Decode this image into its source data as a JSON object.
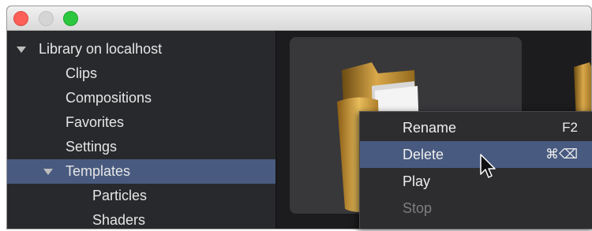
{
  "window": {
    "controls": {
      "close": "close-button",
      "minimize": "minimize-button",
      "zoom": "zoom-button"
    }
  },
  "sidebar": {
    "root_label": "Library on localhost",
    "items": [
      {
        "label": "Clips"
      },
      {
        "label": "Compositions"
      },
      {
        "label": "Favorites"
      },
      {
        "label": "Settings"
      },
      {
        "label": "Templates",
        "selected": true,
        "expanded": true
      },
      {
        "label": "Particles"
      },
      {
        "label": "Shaders"
      }
    ]
  },
  "main": {
    "icons": [
      "folder-icon",
      "folder-icon"
    ]
  },
  "context_menu": {
    "items": [
      {
        "label": "Rename",
        "shortcut": "F2",
        "enabled": true
      },
      {
        "label": "Delete",
        "shortcut": "⌘⌫",
        "enabled": true,
        "highlighted": true
      },
      {
        "label": "Play",
        "shortcut": "",
        "enabled": true
      },
      {
        "label": "Stop",
        "shortcut": "",
        "enabled": false
      }
    ]
  },
  "colors": {
    "selection": "#485a7f",
    "sidebar_bg": "#28292c",
    "content_bg": "#1c1c1e",
    "menu_bg": "#2d2d2f",
    "folder_gold": "#d9a84a"
  }
}
